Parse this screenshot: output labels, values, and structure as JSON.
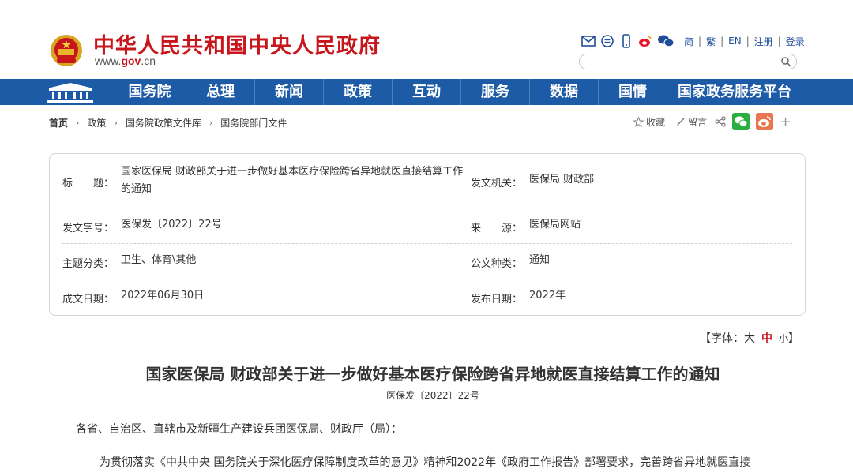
{
  "header": {
    "site_title": "中华人民共和国中央人民政府",
    "site_url_prefix": "www.",
    "site_url_domain": "gov",
    "site_url_suffix": ".cn",
    "top_icons": [
      "mail-icon",
      "chat-bubble-icon",
      "mobile-phone-icon",
      "weibo-icon",
      "wechat-icon"
    ],
    "lang_links": [
      "简",
      "繁",
      "EN"
    ],
    "separator": "|",
    "register": "注册",
    "login": "登录",
    "search_placeholder": ""
  },
  "nav": {
    "items": [
      "国务院",
      "总理",
      "新闻",
      "政策",
      "互动",
      "服务",
      "数据",
      "国情",
      "国家政务服务平台"
    ]
  },
  "breadcrumb": {
    "items": [
      "首页",
      "政策",
      "国务院政策文件库",
      "国务院部门文件"
    ],
    "arrow": "›"
  },
  "tools": {
    "favorite": "收藏",
    "comment": "留言",
    "plus": "+"
  },
  "info": {
    "title_label": "标　　题：",
    "title_value": "国家医保局 财政部关于进一步做好基本医疗保险跨省异地就医直接结算工作的通知",
    "issuer_label": "发文机关：",
    "issuer_value": "医保局 财政部",
    "docnum_label": "发文字号：",
    "docnum_value": "医保发〔2022〕22号",
    "source_label": "来　　源：",
    "source_value": "医保局网站",
    "topic_label": "主题分类：",
    "topic_value": "卫生、体育\\其他",
    "doctype_label": "公文种类：",
    "doctype_value": "通知",
    "date_label": "成文日期：",
    "date_value": "2022年06月30日",
    "pub_label": "发布日期：",
    "pub_value": "2022年"
  },
  "fontsize": {
    "prefix": "【字体：",
    "large": "大",
    "medium": "中",
    "small": "小",
    "suffix": "】"
  },
  "document": {
    "title": "国家医保局 财政部关于进一步做好基本医疗保险跨省异地就医直接结算工作的通知",
    "number": "医保发〔2022〕22号",
    "salutation": "各省、自治区、直辖市及新疆生产建设兵团医保局、财政厅（局）：",
    "para1": "为贯彻落实《中共中央 国务院关于深化医疗保障制度改革的意见》精神和2022年《政府工作报告》部署要求，完善跨省异地就医直接"
  },
  "colors": {
    "brand_red": "#c8161d",
    "nav_blue": "#1d5ba6",
    "link_blue": "#1f4e9b",
    "wechat_green": "#2bae3f",
    "weibo_orange": "#e8764e"
  }
}
